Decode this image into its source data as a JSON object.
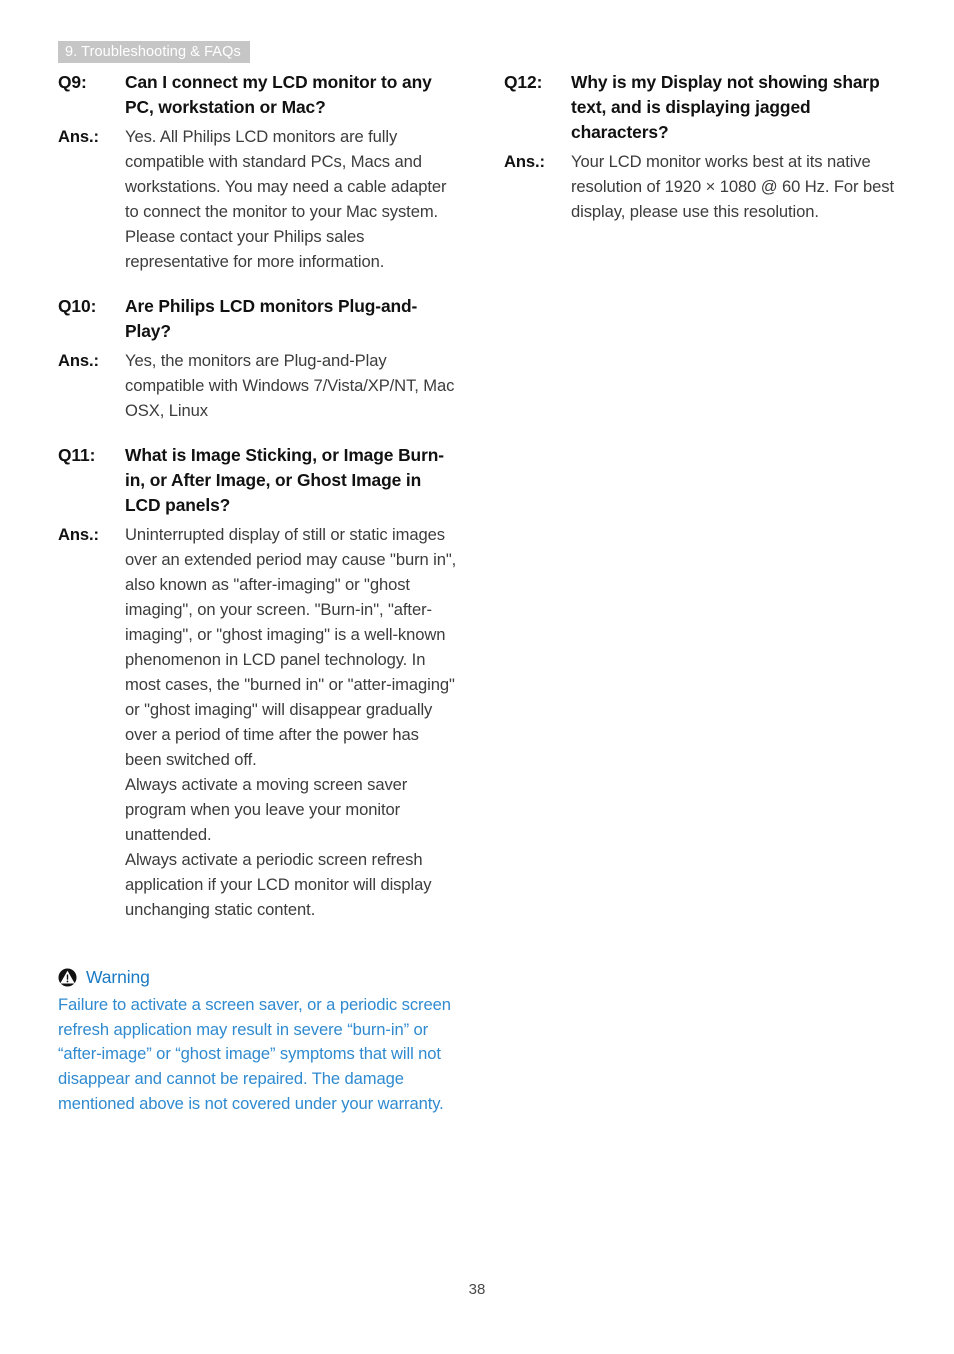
{
  "document": {
    "chapter_banner": "9. Troubleshooting & FAQs",
    "page_number": "38"
  },
  "left_column": {
    "q9": {
      "label": "Q9:",
      "question": "Can I connect my LCD monitor to any PC, workstation or Mac?",
      "answer_label": "Ans.:",
      "answer": "Yes. All Philips LCD monitors are fully compatible with standard PCs, Macs and workstations. You may need a cable adapter to connect the monitor to your Mac system. Please contact your Philips sales representative for more information."
    },
    "q10": {
      "label": "Q10:",
      "question": "Are Philips LCD monitors Plug-and-Play?",
      "answer_label": "Ans.:",
      "answer": "Yes, the monitors are Plug-and-Play compatible with Windows 7/Vista/XP/NT, Mac OSX, Linux"
    },
    "q11": {
      "label": "Q11:",
      "question": "What is Image Sticking, or Image Burn-in, or After Image, or Ghost Image in LCD panels?",
      "answer_label": "Ans.:",
      "answer_paragraph_1": "Uninterrupted display of still or static images over an extended period may cause \"burn in\", also known as \"after-imaging\" or \"ghost imaging\", on your screen. \"Burn-in\", \"after-imaging\", or \"ghost imaging\" is a well-known phenomenon in LCD panel technology. In most cases, the \"burned in\" or \"atter-imaging\" or \"ghost imaging\" will disappear gradually over a period of time after the power has been switched off.",
      "answer_paragraph_2": "Always activate a moving screen saver program when you leave your monitor unattended.",
      "answer_paragraph_3": "Always activate a periodic screen refresh application if your LCD monitor will display unchanging static content."
    },
    "warning": {
      "icon": "warning-triangle-icon",
      "title": "Warning",
      "body": "Failure to activate a screen saver, or a periodic screen refresh application may result in severe “burn-in” or “after-image” or “ghost image” symptoms that will not disappear and cannot be repaired. The damage mentioned above is not covered under your warranty."
    }
  },
  "right_column": {
    "q12": {
      "label": "Q12:",
      "question": "Why is my Display not showing sharp text, and is displaying jagged characters?",
      "answer_label": "Ans.:",
      "answer": "Your LCD monitor works best at its native resolution of 1920 × 1080 @ 60 Hz. For best display, please use this resolution."
    }
  },
  "colors": {
    "banner_background": "#c6c6c6",
    "banner_text": "#ffffff",
    "heading_text": "#111111",
    "body_text": "#3c3c3c",
    "warning_title": "#1a7ac4",
    "warning_body": "#2f8ad0"
  }
}
